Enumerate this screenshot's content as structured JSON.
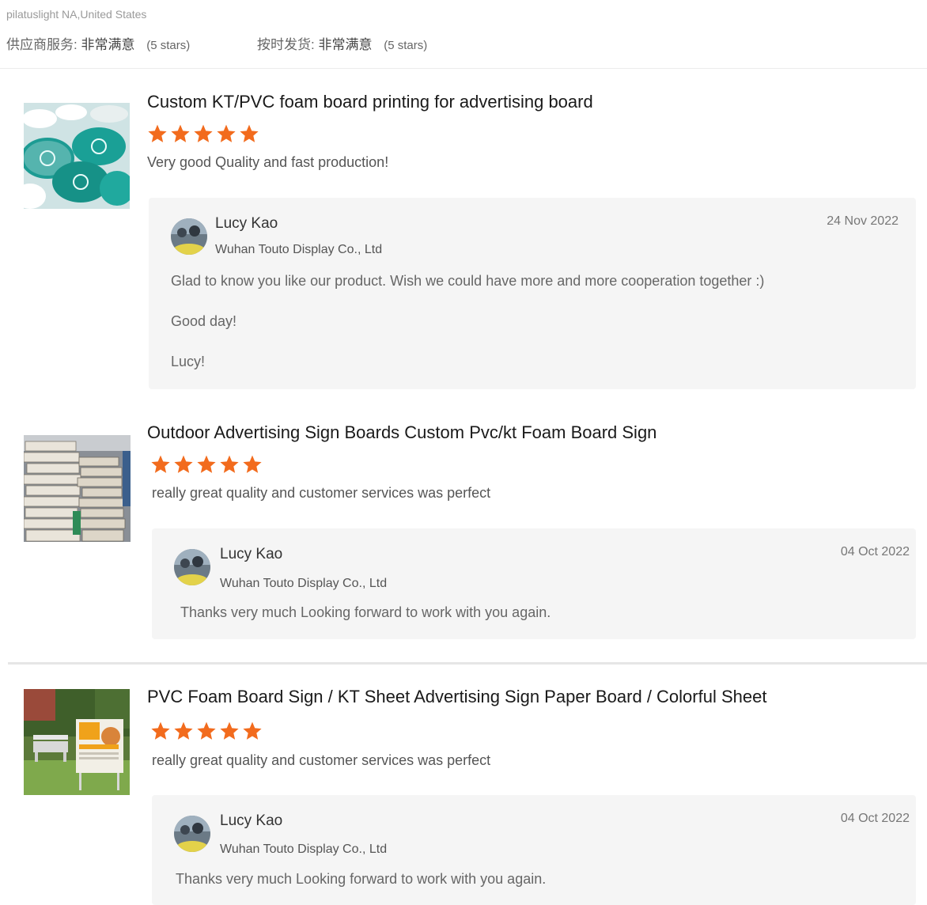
{
  "buyer": {
    "name_location": "pilatuslight NA,United States"
  },
  "ratings": [
    {
      "label": "供应商服务:",
      "value": "非常满意",
      "stars_note": "(5 stars)"
    },
    {
      "label": "按时发货:",
      "value": "非常满意",
      "stars_note": "(5 stars)"
    }
  ],
  "colors": {
    "star": "#f26b1d",
    "reply_bg": "#f5f5f5",
    "divider": "#e6e6e6"
  },
  "reviews": [
    {
      "product_title": "Custom KT/PVC foam board printing for advertising board",
      "rating": 5,
      "comment": "Very good Quality and fast production!",
      "thumbnail": "teal-round-foam-boards-image",
      "reply": {
        "seller_name": "Lucy Kao",
        "company": "Wuhan Touto Display Co., Ltd",
        "date": "24 Nov 2022",
        "lines": [
          "Glad to know you like our product. Wish we could have more and more cooperation together :)",
          "Good day!",
          "Lucy!"
        ]
      }
    },
    {
      "product_title": "Outdoor Advertising Sign Boards Custom Pvc/kt Foam Board Sign",
      "rating": 5,
      "comment": "really great quality and customer services was perfect",
      "thumbnail": "stacked-boards-image",
      "reply": {
        "seller_name": "Lucy Kao",
        "company": "Wuhan Touto Display Co., Ltd",
        "date": "04 Oct 2022",
        "lines": [
          "Thanks very much Looking forward to work with you again."
        ]
      }
    },
    {
      "product_title": "PVC Foam Board Sign / KT Sheet Advertising Sign Paper Board / Colorful Sheet",
      "rating": 5,
      "comment": "really great quality and customer services was perfect",
      "thumbnail": "garden-sign-image",
      "reply": {
        "seller_name": "Lucy Kao",
        "company": "Wuhan Touto Display Co., Ltd",
        "date": "04 Oct 2022",
        "lines": [
          "Thanks very much Looking forward to work with you again."
        ]
      }
    }
  ]
}
